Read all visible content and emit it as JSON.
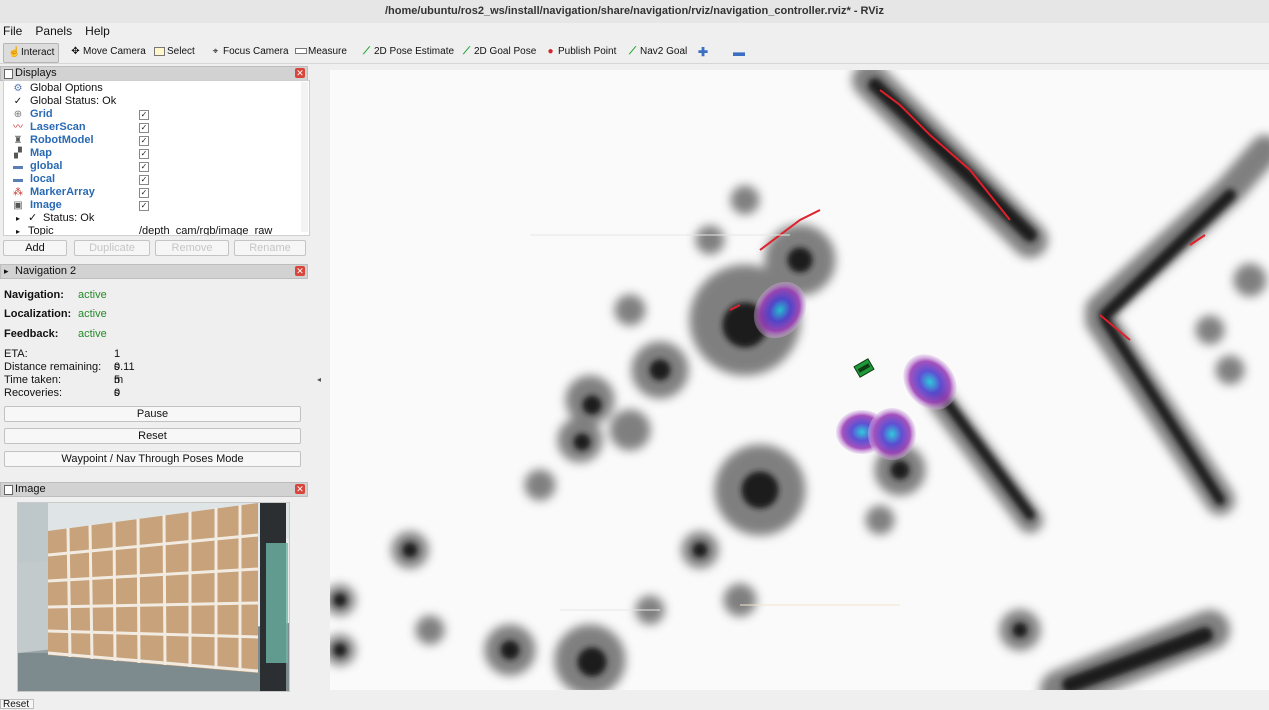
{
  "window": {
    "title": "/home/ubuntu/ros2_ws/install/navigation/share/navigation/rviz/navigation_controller.rviz* - RViz"
  },
  "menu": [
    "File",
    "Panels",
    "Help"
  ],
  "toolbar": {
    "tools": [
      {
        "label": "Interact",
        "icon": "hand-icon"
      },
      {
        "label": "Move Camera",
        "icon": "move-camera-icon"
      },
      {
        "label": "Select",
        "icon": "select-box-icon"
      },
      {
        "label": "Focus Camera",
        "icon": "focus-crosshair-icon"
      },
      {
        "label": "Measure",
        "icon": "ruler-icon"
      },
      {
        "label": "2D Pose Estimate",
        "icon": "green-arrow-icon"
      },
      {
        "label": "2D Goal Pose",
        "icon": "green-arrow-icon"
      },
      {
        "label": "Publish Point",
        "icon": "red-pin-icon"
      },
      {
        "label": "Nav2 Goal",
        "icon": "green-arrow-icon"
      }
    ],
    "extra": [
      "plus-icon",
      "minus-icon"
    ]
  },
  "displays": {
    "title": "Displays",
    "items": [
      {
        "label": "Global Options",
        "icon": "gear-icon",
        "checked": null,
        "style": "plain"
      },
      {
        "label": "Global Status: Ok",
        "icon": "check-icon",
        "checked": null,
        "style": "plain"
      },
      {
        "label": "Grid",
        "icon": "grid-icon",
        "checked": true,
        "style": "blue"
      },
      {
        "label": "LaserScan",
        "icon": "laserscan-icon",
        "checked": true,
        "style": "blue"
      },
      {
        "label": "RobotModel",
        "icon": "robot-icon",
        "checked": true,
        "style": "blue"
      },
      {
        "label": "Map",
        "icon": "map-icon",
        "checked": true,
        "style": "blue"
      },
      {
        "label": "global",
        "icon": "folder-icon",
        "checked": true,
        "style": "blue"
      },
      {
        "label": "local",
        "icon": "folder-icon",
        "checked": true,
        "style": "blue"
      },
      {
        "label": "MarkerArray",
        "icon": "markers-icon",
        "checked": true,
        "style": "blue"
      },
      {
        "label": "Image",
        "icon": "image-icon",
        "checked": true,
        "style": "blue"
      }
    ],
    "sub_items": [
      {
        "label": "Status: Ok",
        "value": ""
      },
      {
        "label": "Topic",
        "value": "/depth_cam/rgb/image_raw"
      }
    ],
    "buttons": {
      "add": "Add",
      "duplicate": "Duplicate",
      "remove": "Remove",
      "rename": "Rename"
    }
  },
  "navigation": {
    "title": "Navigation 2",
    "status": [
      {
        "key": "Navigation:",
        "value": "active"
      },
      {
        "key": "Localization:",
        "value": "active"
      },
      {
        "key": "Feedback:",
        "value": "active"
      }
    ],
    "info": [
      {
        "key": "ETA:",
        "value": "1 s"
      },
      {
        "key": "Distance remaining:",
        "value": "0.11 m"
      },
      {
        "key": "Time taken:",
        "value": "5 s"
      },
      {
        "key": "Recoveries:",
        "value": "0"
      }
    ],
    "buttons": {
      "pause": "Pause",
      "reset": "Reset",
      "waypoint": "Waypoint / Nav Through Poses Mode"
    }
  },
  "image_panel": {
    "title": "Image"
  },
  "bottom": {
    "reset": "Reset"
  },
  "colors": {
    "active_green": "#268a2a",
    "display_blue": "#2a6ab3",
    "close_red": "#d9453b",
    "inflation_purple": "#7b2fb8",
    "costmap_cyan": "#19c6d8",
    "laser_red": "#e0202a"
  }
}
